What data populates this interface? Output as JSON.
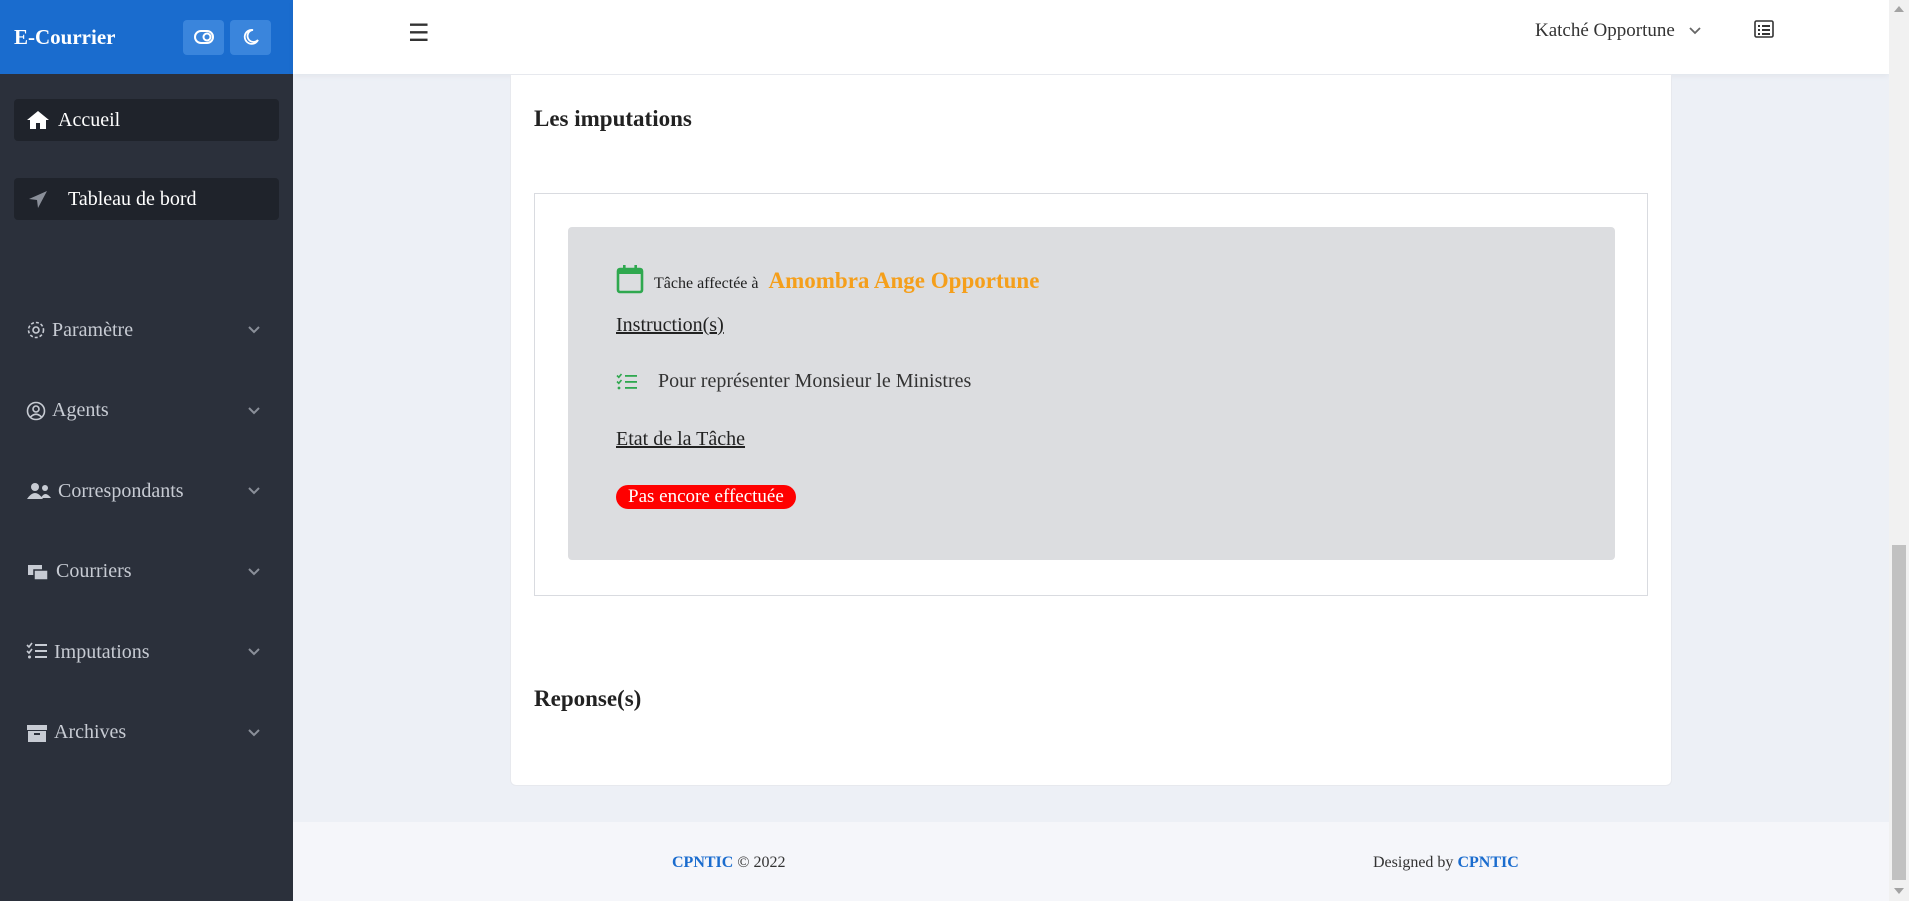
{
  "sidebar": {
    "brand": "E-Courrier",
    "toggle_icon": "toggle-icon",
    "moon_icon": "moon-icon",
    "main_items": [
      {
        "label": "Accueil",
        "icon": "home-icon"
      },
      {
        "label": "Tableau de bord",
        "icon": "location-arrow-icon"
      }
    ],
    "items": [
      {
        "label": "Paramètre",
        "icon": "gear-icon"
      },
      {
        "label": "Agents",
        "icon": "user-circle-icon"
      },
      {
        "label": "Correspondants",
        "icon": "users-icon"
      },
      {
        "label": "Courriers",
        "icon": "mail-stack-icon"
      },
      {
        "label": "Imputations",
        "icon": "tasks-icon"
      },
      {
        "label": "Archives",
        "icon": "archive-icon"
      }
    ]
  },
  "topbar": {
    "menu_glyph": "☰",
    "user_name": "Katché Opportune"
  },
  "card": {
    "title": "Les imputations",
    "task": {
      "assigned_label": "Tâche affectée à",
      "assignee": "Amombra Ange Opportune",
      "instructions_label": "Instruction(s)",
      "instruction_text": "Pour représenter Monsieur le Ministres",
      "state_label": "Etat de la Tâche",
      "state_badge": "Pas encore effectuée"
    },
    "responses_title": "Reponse(s)"
  },
  "footer": {
    "brand": "CPNTIC",
    "copyright": "© 2022",
    "designed_by": "Designed by",
    "designer": "CPNTIC"
  },
  "colors": {
    "brand_blue": "#1a6cce",
    "sidebar_bg": "#2b303b",
    "assignee_orange": "#f59f1b",
    "badge_red": "#ff0000",
    "icon_green": "#2fa84f"
  }
}
